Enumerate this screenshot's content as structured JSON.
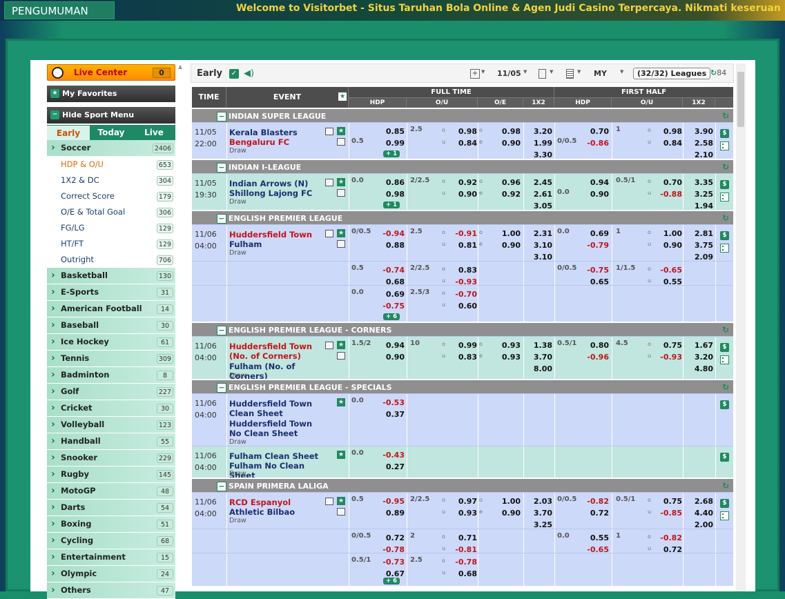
{
  "announcement": {
    "label": "PENGUMUMAN",
    "text": "Welcome to Visitorbet - Situs Taruhan Bola Online & Agen Judi Casino Terpercaya. Nikmati keseruan bermain berbagai m"
  },
  "sidebar": {
    "live_center": {
      "label": "Live Center",
      "count": "0"
    },
    "favorites": "My Favorites",
    "hide_menu": "Hide Sport Menu",
    "tabs": [
      "Early",
      "Today",
      "Live"
    ],
    "sports": [
      {
        "label": "Soccer",
        "count": "2406",
        "subs": [
          {
            "label": "HDP & O/U",
            "count": "653",
            "selected": true
          },
          {
            "label": "1X2 & DC",
            "count": "304"
          },
          {
            "label": "Correct Score",
            "count": "179"
          },
          {
            "label": "O/E & Total Goal",
            "count": "306"
          },
          {
            "label": "FG/LG",
            "count": "129"
          },
          {
            "label": "HT/FT",
            "count": "129"
          },
          {
            "label": "Outright",
            "count": "706"
          }
        ]
      },
      {
        "label": "Basketball",
        "count": "130"
      },
      {
        "label": "E-Sports",
        "count": "31"
      },
      {
        "label": "American Football",
        "count": "14"
      },
      {
        "label": "Baseball",
        "count": "30"
      },
      {
        "label": "Ice Hockey",
        "count": "61"
      },
      {
        "label": "Tennis",
        "count": "309"
      },
      {
        "label": "Badminton",
        "count": "8"
      },
      {
        "label": "Golf",
        "count": "227"
      },
      {
        "label": "Cricket",
        "count": "30"
      },
      {
        "label": "Volleyball",
        "count": "123"
      },
      {
        "label": "Handball",
        "count": "55"
      },
      {
        "label": "Snooker",
        "count": "229"
      },
      {
        "label": "Rugby",
        "count": "145"
      },
      {
        "label": "MotoGP",
        "count": "48"
      },
      {
        "label": "Darts",
        "count": "54"
      },
      {
        "label": "Boxing",
        "count": "51"
      },
      {
        "label": "Cycling",
        "count": "68"
      },
      {
        "label": "Entertainment",
        "count": "15"
      },
      {
        "label": "Olympic",
        "count": "24"
      },
      {
        "label": "Others",
        "count": "47"
      }
    ]
  },
  "toolbar": {
    "title": "Early",
    "date": "11/05",
    "odds_type": "MY",
    "leagues": "(32/32) Leagues",
    "refresh": "84"
  },
  "table": {
    "headers": {
      "time": "TIME",
      "event": "EVENT",
      "full_time": "FULL TIME",
      "first_half": "FIRST HALF",
      "hdp": "HDP",
      "ou": "O/U",
      "oe": "O/E",
      "x12": "1X2",
      "hdp2": "HDP",
      "ou2": "O/U",
      "x12b": "1X2"
    },
    "leagues": [
      {
        "name": "INDIAN SUPER LEAGUE"
      },
      {
        "name": "INDIAN I-LEAGUE"
      },
      {
        "name": "ENGLISH PREMIER LEAGUE"
      },
      {
        "name": "ENGLISH PREMIER LEAGUE - CORNERS"
      },
      {
        "name": "ENGLISH PREMIER LEAGUE - SPECIALS"
      },
      {
        "name": "SPAIN PRIMERA LALIGA"
      }
    ],
    "matches": [
      {
        "date": "11/05",
        "time": "22:00",
        "home": "Kerala Blasters",
        "away": "Bengaluru FC",
        "draw": "Draw",
        "more": "1",
        "ft_hdp": [
          "",
          "0.5"
        ],
        "ft_hdp_odds": [
          "0.85",
          "0.99"
        ],
        "ft_ou": [
          "2.5",
          ""
        ],
        "ft_ou_odds": [
          "0.98",
          "0.84"
        ],
        "ft_oe": [
          "0.98",
          "0.90"
        ],
        "ft_x12": [
          "3.20",
          "1.99",
          "3.30"
        ],
        "fh_hdp": [
          "",
          "0/0.5"
        ],
        "fh_hdp_odds": [
          "0.70",
          "-0.86"
        ],
        "fh_ou": [
          "1",
          ""
        ],
        "fh_ou_odds": [
          "0.98",
          "0.84"
        ],
        "fh_x12": [
          "3.90",
          "2.58",
          "2.10"
        ]
      },
      {
        "date": "11/05",
        "time": "19:30",
        "home": "Indian Arrows (N)",
        "away": "Shillong Lajong FC",
        "draw": "Draw",
        "more": "1",
        "ft_hdp": [
          "0.0",
          ""
        ],
        "ft_hdp_odds": [
          "0.86",
          "0.98"
        ],
        "ft_ou": [
          "2/2.5",
          ""
        ],
        "ft_ou_odds": [
          "0.92",
          "0.90"
        ],
        "ft_oe": [
          "0.96",
          "0.92"
        ],
        "ft_x12": [
          "2.45",
          "2.61",
          "3.05"
        ],
        "fh_hdp": [
          "",
          "0.0"
        ],
        "fh_hdp_odds": [
          "0.94",
          "0.90"
        ],
        "fh_ou": [
          "0.5/1",
          ""
        ],
        "fh_ou_odds": [
          "0.70",
          "-0.88"
        ],
        "fh_x12": [
          "3.35",
          "3.25",
          "1.94"
        ]
      },
      {
        "date": "11/06",
        "time": "04:00",
        "home": "Huddersfield Town",
        "away": "Fulham",
        "draw": "Draw",
        "ft_hdp": [
          "0/0.5",
          ""
        ],
        "ft_hdp_odds": [
          "-0.94",
          "0.88"
        ],
        "ft_ou": [
          "2.5",
          ""
        ],
        "ft_ou_odds": [
          "-0.91",
          "0.81"
        ],
        "ft_oe": [
          "1.00",
          "0.90"
        ],
        "ft_x12": [
          "2.31",
          "3.10",
          "3.10"
        ],
        "fh_hdp": [
          "0.0",
          ""
        ],
        "fh_hdp_odds": [
          "0.69",
          "-0.79"
        ],
        "fh_ou": [
          "1",
          ""
        ],
        "fh_ou_odds": [
          "1.00",
          "0.90"
        ],
        "fh_x12": [
          "2.81",
          "3.75",
          "2.09"
        ]
      },
      {
        "ft_hdp": [
          "0.5",
          ""
        ],
        "ft_hdp_odds": [
          "-0.74",
          "0.68"
        ],
        "ft_ou": [
          "2/2.5",
          ""
        ],
        "ft_ou_odds": [
          "0.83",
          "-0.93"
        ],
        "fh_hdp": [
          "0/0.5",
          ""
        ],
        "fh_hdp_odds": [
          "-0.75",
          "0.65"
        ],
        "fh_ou": [
          "1/1.5",
          ""
        ],
        "fh_ou_odds": [
          "-0.65",
          "0.55"
        ]
      },
      {
        "ft_hdp": [
          "0.0",
          ""
        ],
        "ft_hdp_odds": [
          "0.69",
          "-0.75"
        ],
        "ft_ou": [
          "2.5/3",
          ""
        ],
        "ft_ou_odds": [
          "-0.70",
          "0.60"
        ],
        "more": "6"
      },
      {
        "date": "11/06",
        "time": "04:00",
        "home": "Huddersfield Town (No. of Corners)",
        "away": "Fulham (No. of Corners)",
        "draw": "Draw",
        "ft_hdp": [
          "1.5/2",
          ""
        ],
        "ft_hdp_odds": [
          "0.94",
          "0.90"
        ],
        "ft_ou": [
          "10",
          ""
        ],
        "ft_ou_odds": [
          "0.99",
          "0.83"
        ],
        "ft_oe": [
          "0.93",
          "0.93"
        ],
        "ft_x12": [
          "1.38",
          "3.70",
          "8.00"
        ],
        "fh_hdp": [
          "0.5/1",
          ""
        ],
        "fh_hdp_odds": [
          "0.80",
          "-0.96"
        ],
        "fh_ou": [
          "4.5",
          ""
        ],
        "fh_ou_odds": [
          "0.75",
          "-0.93"
        ],
        "fh_x12": [
          "1.67",
          "3.20",
          "4.80"
        ]
      },
      {
        "date": "11/06",
        "time": "04:00",
        "home": "Huddersfield Town Clean Sheet",
        "away": "Huddersfield Town No Clean Sheet",
        "draw": "Draw",
        "ft_hdp": [
          "0.0",
          ""
        ],
        "ft_hdp_odds": [
          "-0.53",
          "0.37"
        ]
      },
      {
        "date": "11/06",
        "time": "04:00",
        "home": "Fulham Clean Sheet",
        "away": "Fulham No Clean Sheet",
        "draw": "Draw",
        "ft_hdp": [
          "0.0",
          ""
        ],
        "ft_hdp_odds": [
          "-0.43",
          "0.27"
        ]
      },
      {
        "date": "11/06",
        "time": "04:00",
        "home": "RCD Espanyol",
        "away": "Athletic Bilbao",
        "draw": "Draw",
        "ft_hdp": [
          "0.5",
          ""
        ],
        "ft_hdp_odds": [
          "-0.95",
          "0.89"
        ],
        "ft_ou": [
          "2/2.5",
          ""
        ],
        "ft_ou_odds": [
          "0.97",
          "0.93"
        ],
        "ft_oe": [
          "1.00",
          "0.90"
        ],
        "ft_x12": [
          "2.03",
          "3.70",
          "3.25"
        ],
        "fh_hdp": [
          "0/0.5",
          ""
        ],
        "fh_hdp_odds": [
          "-0.82",
          "0.72"
        ],
        "fh_ou": [
          "0.5/1",
          ""
        ],
        "fh_ou_odds": [
          "0.75",
          "-0.85"
        ],
        "fh_x12": [
          "2.68",
          "4.40",
          "2.00"
        ]
      },
      {
        "ft_hdp": [
          "0/0.5",
          ""
        ],
        "ft_hdp_odds": [
          "0.72",
          "-0.78"
        ],
        "ft_ou": [
          "2",
          ""
        ],
        "ft_ou_odds": [
          "0.71",
          "-0.81"
        ],
        "fh_hdp": [
          "0.0",
          ""
        ],
        "fh_hdp_odds": [
          "0.55",
          "-0.65"
        ],
        "fh_ou": [
          "1",
          ""
        ],
        "fh_ou_odds": [
          "-0.82",
          "0.72"
        ]
      },
      {
        "ft_hdp": [
          "0.5/1",
          ""
        ],
        "ft_hdp_odds": [
          "-0.73",
          "0.67"
        ],
        "ft_ou": [
          "2.5",
          ""
        ],
        "ft_ou_odds": [
          "-0.78",
          "0.68"
        ],
        "more": "6"
      }
    ],
    "ou_marks": [
      "o",
      "u"
    ],
    "oe_marks": [
      "o",
      "e"
    ]
  }
}
